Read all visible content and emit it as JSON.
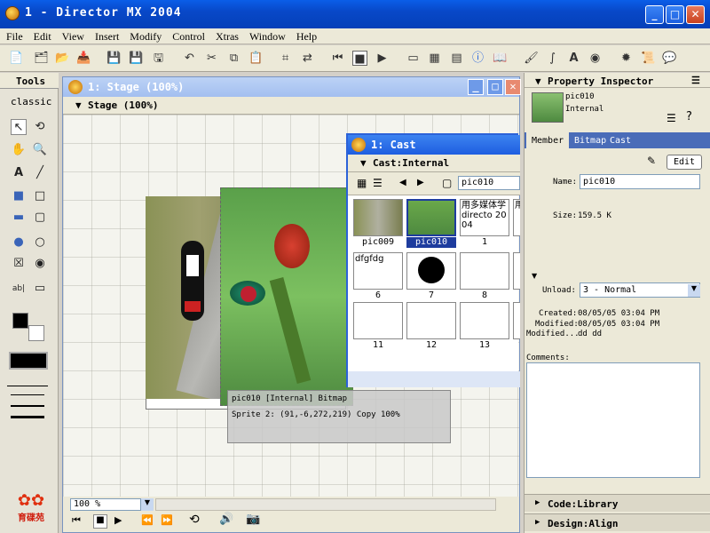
{
  "window": {
    "title": "1 - Director MX 2004"
  },
  "menu": [
    "File",
    "Edit",
    "View",
    "Insert",
    "Modify",
    "Control",
    "Xtras",
    "Window",
    "Help"
  ],
  "tools": {
    "title": "Tools",
    "palette": "classic"
  },
  "stage": {
    "window_title": "1: Stage (100%)",
    "panel_title": "Stage (100%)",
    "zoom": "100 %",
    "tooltip": {
      "line1": "pic010 [Internal] Bitmap",
      "line2": "Sprite 2: (91,-6,272,219) Copy 100%"
    }
  },
  "cast": {
    "window_title": "1: Cast",
    "panel_title": "Cast:Internal",
    "member_field": "pic010",
    "members": [
      {
        "label": "pic009",
        "num": "",
        "kind": "bitmap"
      },
      {
        "label": "pic010",
        "num": "",
        "kind": "bitmap",
        "selected": true
      },
      {
        "label": "1",
        "num": "",
        "kind": "text",
        "text": "用多媒体学 directo 2004"
      },
      {
        "label": "",
        "num": "",
        "kind": "text-partial",
        "text": "用 学 d"
      },
      {
        "label": "6",
        "num": "",
        "kind": "text",
        "text": "dfgfdg"
      },
      {
        "label": "7",
        "num": "",
        "kind": "shape"
      },
      {
        "label": "8",
        "num": "",
        "kind": "empty"
      },
      {
        "label": "",
        "num": "",
        "kind": "empty"
      },
      {
        "label": "11",
        "num": "",
        "kind": "empty"
      },
      {
        "label": "12",
        "num": "",
        "kind": "empty"
      },
      {
        "label": "13",
        "num": "",
        "kind": "empty"
      },
      {
        "label": "",
        "num": "",
        "kind": "empty"
      }
    ]
  },
  "inspector": {
    "title": "Property Inspector",
    "member_name": "pic010",
    "member_location": "Internal",
    "tabs": [
      "Member",
      "Bitmap",
      "Cast"
    ],
    "edit_label": "Edit",
    "name_label": "Name:",
    "name_value": "pic010",
    "size_label": "Size:",
    "size_value": "159.5 K",
    "unload_label": "Unload:",
    "unload_value": "3 - Normal",
    "created_label": "Created:",
    "created_value": "08/05/05 03:04 PM",
    "modified_label": "Modified:",
    "modified_value": "08/05/05 03:04 PM",
    "modifiedby_label": "Modified...",
    "modifiedby_value": "dd dd",
    "comments_label": "Comments:",
    "panel_code": "Code:Library",
    "panel_design": "Design:Align"
  },
  "logo": {
    "text": "育碟苑"
  },
  "colors": {
    "accent": "#1e5ee0",
    "stage_bg": "#f4f4ee",
    "selected_cell": "#1e3c9e"
  }
}
